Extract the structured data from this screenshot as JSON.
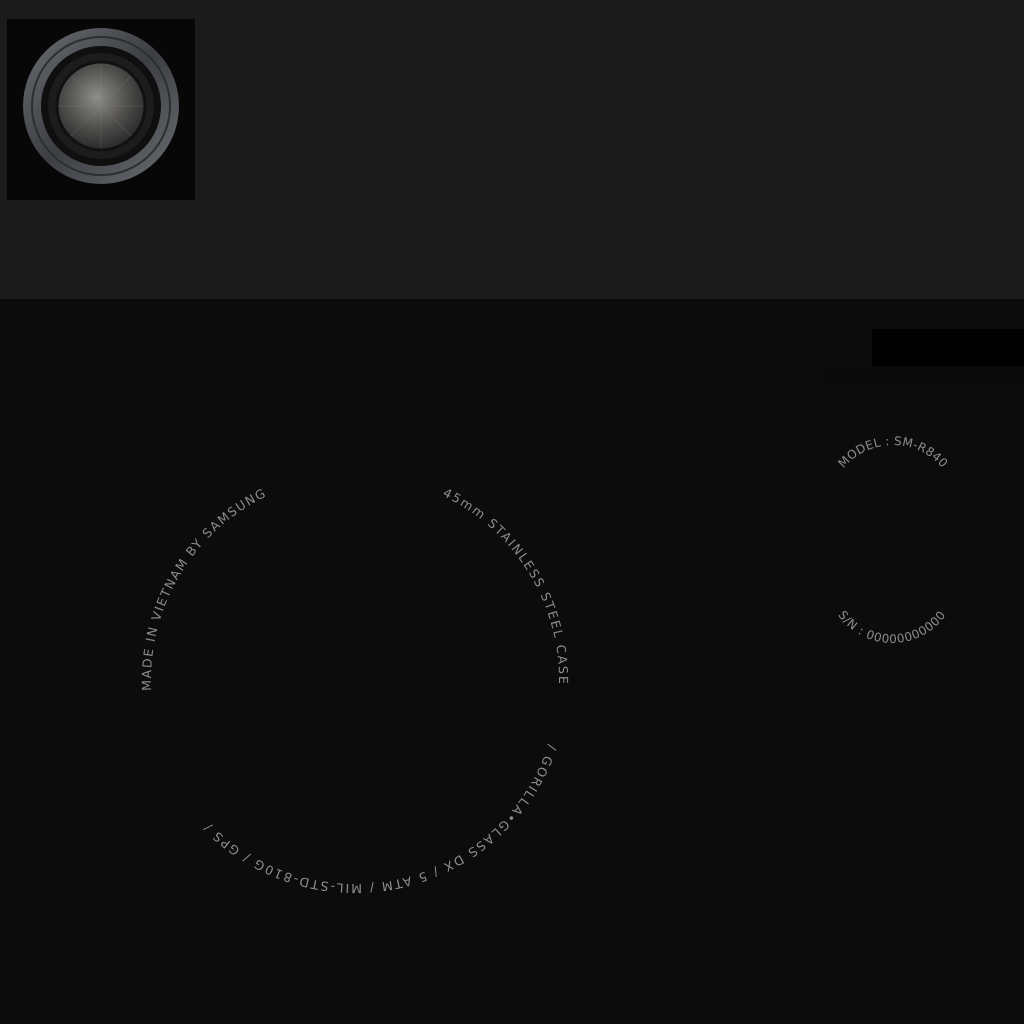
{
  "back_ring": {
    "upper_right_text": "45mm  STAINLESS STEEL  CASE",
    "lower_text": "/  GORILLA•GLASS DX  /  5 ATM  /  MIL-STD-810G  /  GPS  /",
    "upper_left_text": "MADE IN VIETNAM BY SAMSUNG"
  },
  "id_ring": {
    "model_text": "MODEL : SM-R840",
    "serial_text": "S/N : 00000000000"
  },
  "colors": {
    "top_panel": "#1b1b1b",
    "background": "#0c0c0c",
    "engraving_text": "#8d8d8d"
  }
}
